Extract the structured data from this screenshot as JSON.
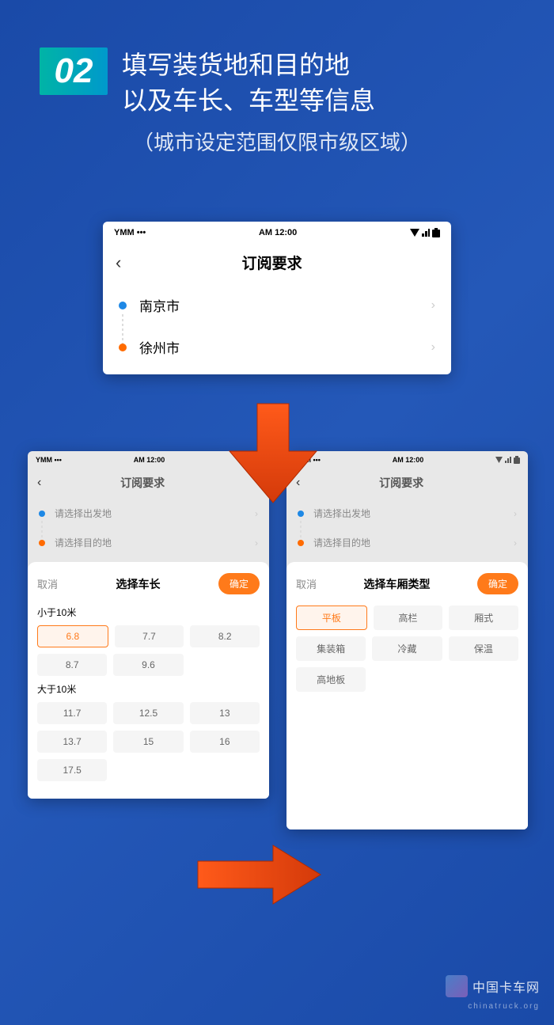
{
  "step": {
    "num": "02",
    "title_l1": "填写装货地和目的地",
    "title_l2": "以及车长、车型等信息",
    "subtitle": "（城市设定范围仅限市级区域）"
  },
  "status": {
    "carrier": "YMM •••",
    "time": "AM 12:00"
  },
  "nav": {
    "title": "订阅要求"
  },
  "top_screen": {
    "origin": "南京市",
    "dest": "徐州市"
  },
  "dim_screen": {
    "origin_ph": "请选择出发地",
    "dest_ph": "请选择目的地"
  },
  "length_sheet": {
    "cancel": "取消",
    "title": "选择车长",
    "confirm": "确定",
    "section1": "小于10米",
    "row1": [
      "6.8",
      "7.7",
      "8.2"
    ],
    "row2": [
      "8.7",
      "9.6",
      ""
    ],
    "section2": "大于10米",
    "row3": [
      "11.7",
      "12.5",
      "13"
    ],
    "row4": [
      "13.7",
      "15",
      "16"
    ],
    "row5": [
      "17.5",
      "",
      ""
    ]
  },
  "type_sheet": {
    "cancel": "取消",
    "title": "选择车厢类型",
    "confirm": "确定",
    "row1": [
      "平板",
      "高栏",
      "厢式"
    ],
    "row2": [
      "集装箱",
      "冷藏",
      "保温"
    ],
    "row3": [
      "高地板",
      "",
      ""
    ]
  },
  "watermark": {
    "text": "中国卡车网",
    "sub": "chinatruck.org"
  }
}
